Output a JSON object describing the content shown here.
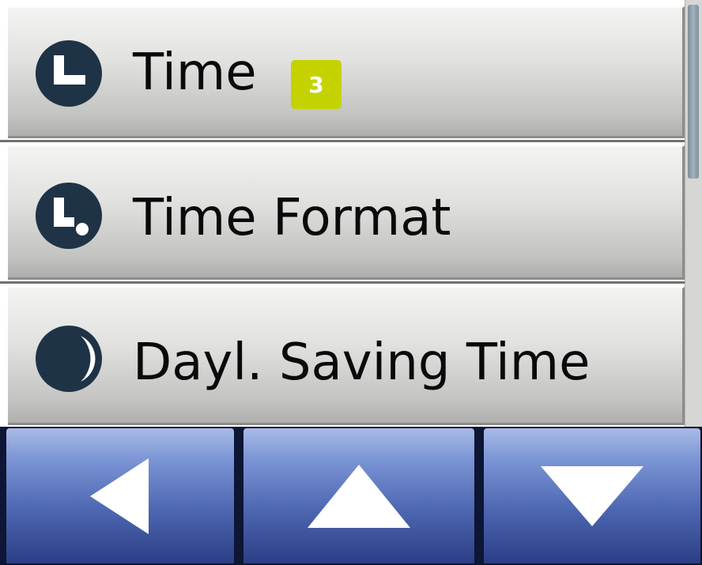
{
  "menu": {
    "items": [
      {
        "label": "Time",
        "icon": "clock-icon",
        "badge": "3"
      },
      {
        "label": "Time Format",
        "icon": "clock-format-icon"
      },
      {
        "label": "Dayl. Saving Time",
        "icon": "half-moon-icon"
      }
    ]
  },
  "navigation": {
    "buttons": [
      {
        "name": "back",
        "icon": "triangle-left-icon"
      },
      {
        "name": "up",
        "icon": "triangle-up-icon"
      },
      {
        "name": "down",
        "icon": "triangle-down-icon"
      }
    ]
  },
  "colors": {
    "icon": "#1f3347",
    "badge": "#c4d300",
    "nav_button": "#4e67b2"
  }
}
